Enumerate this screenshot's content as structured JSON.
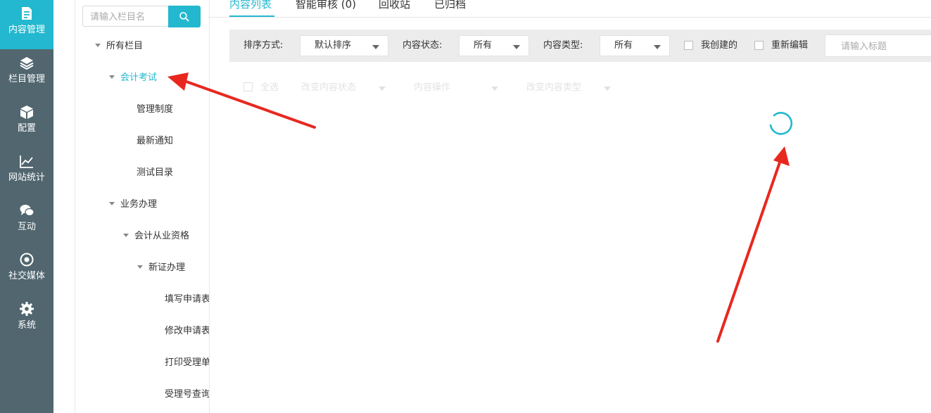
{
  "nav": {
    "items": [
      {
        "label": "内容管理",
        "icon": "document-icon",
        "active": true
      },
      {
        "label": "栏目管理",
        "icon": "layers-icon"
      },
      {
        "label": "配置",
        "icon": "cube-icon"
      },
      {
        "label": "网站统计",
        "icon": "line-chart-icon"
      },
      {
        "label": "互动",
        "icon": "chat-icon"
      },
      {
        "label": "社交媒体",
        "icon": "target-icon"
      },
      {
        "label": "系统",
        "icon": "gear-icon"
      }
    ]
  },
  "tree": {
    "search_placeholder": "请输入栏目名",
    "nodes": [
      {
        "label": "所有栏目"
      },
      {
        "label": "会计考试",
        "active": true
      },
      {
        "label": "管理制度"
      },
      {
        "label": "最新通知"
      },
      {
        "label": "测试目录"
      },
      {
        "label": "业务办理"
      },
      {
        "label": "会计从业资格"
      },
      {
        "label": "新证办理"
      },
      {
        "label": "填写申请表"
      },
      {
        "label": "修改申请表"
      },
      {
        "label": "打印受理单"
      },
      {
        "label": "受理号查询"
      }
    ]
  },
  "tabs": [
    {
      "label": "内容列表",
      "active": true
    },
    {
      "label": "智能审核 (0)"
    },
    {
      "label": "回收站"
    },
    {
      "label": "已归档"
    }
  ],
  "filters": {
    "sort_label": "排序方式:",
    "sort_value": "默认排序",
    "status_label": "内容状态:",
    "status_value": "所有",
    "type_label": "内容类型:",
    "type_value": "所有",
    "my_created_label": "我创建的",
    "reedit_label": "重新编辑",
    "title_placeholder": "请输入标题"
  },
  "bulk_actions": {
    "select_all": "全选",
    "change_status": "改变内容状态",
    "content_ops": "内容操作",
    "change_type": "改变内容类型"
  },
  "colors": {
    "accent": "#23b8cf",
    "nav_bg": "#51666f",
    "annotation_arrow": "#e8281f"
  }
}
